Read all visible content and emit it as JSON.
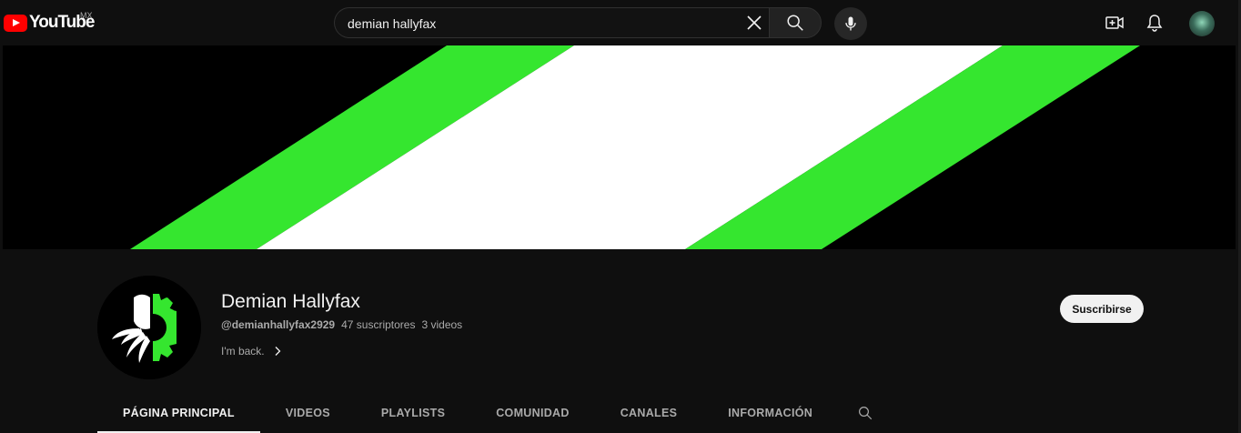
{
  "header": {
    "logo_text": "YouTube",
    "country_code": "MX",
    "search_value": "demian hallyfax",
    "icons": [
      "close-icon",
      "search-icon",
      "mic-icon",
      "create-video-icon",
      "bell-icon",
      "account-avatar"
    ]
  },
  "banner": {
    "colors": {
      "background": "#000000",
      "green": "#35e62f",
      "white": "#ffffff"
    }
  },
  "channel": {
    "name": "Demian Hallyfax",
    "handle": "@demianhallyfax2929",
    "subscribers": "47 suscriptores",
    "videos": "3 videos",
    "description": "I'm back.",
    "subscribe_label": "Suscribirse"
  },
  "tabs": [
    {
      "label": "PÁGINA PRINCIPAL",
      "active": true
    },
    {
      "label": "VIDEOS",
      "active": false
    },
    {
      "label": "PLAYLISTS",
      "active": false
    },
    {
      "label": "COMUNIDAD",
      "active": false
    },
    {
      "label": "CANALES",
      "active": false
    },
    {
      "label": "INFORMACIÓN",
      "active": false
    }
  ],
  "colors": {
    "background": "#0f0f0f",
    "text": "#f1f1f1",
    "muted": "#aaaaaa",
    "accent_red": "#ff0000"
  }
}
